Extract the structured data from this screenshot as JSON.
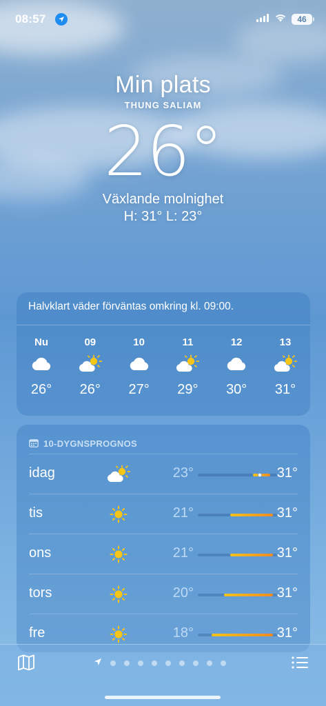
{
  "status_bar": {
    "time": "08:57",
    "battery": "46",
    "icons": [
      "location-arrow-icon",
      "cellular-signal-icon",
      "wifi-icon",
      "battery-icon"
    ]
  },
  "current": {
    "location": "Min plats",
    "sublocation": "THUNG SALIAM",
    "temperature": "26°",
    "condition": "Växlande molnighet",
    "hilo": "H: 31°  L: 23°"
  },
  "hourly": {
    "summary": "Halvklart väder förväntas omkring kl. 09:00.",
    "items": [
      {
        "label": "Nu",
        "icon": "cloud-icon",
        "temp": "26°"
      },
      {
        "label": "09",
        "icon": "partly-cloudy-icon",
        "temp": "26°"
      },
      {
        "label": "10",
        "icon": "cloud-icon",
        "temp": "27°"
      },
      {
        "label": "11",
        "icon": "partly-cloudy-icon",
        "temp": "29°"
      },
      {
        "label": "12",
        "icon": "cloud-icon",
        "temp": "30°"
      },
      {
        "label": "13",
        "icon": "partly-cloudy-icon",
        "temp": "31°"
      }
    ]
  },
  "daily": {
    "header": "10-DYGNSPROGNOS",
    "range": [
      18,
      31
    ],
    "days": [
      {
        "name": "idag",
        "icon": "partly-cloudy-icon",
        "low": "23°",
        "high": "31°",
        "low_val": 23,
        "high_val": 31,
        "current_val": 26
      },
      {
        "name": "tis",
        "icon": "sun-icon",
        "low": "21°",
        "high": "31°",
        "low_val": 21,
        "high_val": 31
      },
      {
        "name": "ons",
        "icon": "sun-icon",
        "low": "21°",
        "high": "31°",
        "low_val": 21,
        "high_val": 31
      },
      {
        "name": "tors",
        "icon": "sun-icon",
        "low": "20°",
        "high": "31°",
        "low_val": 20,
        "high_val": 31
      },
      {
        "name": "fre",
        "icon": "sun-icon",
        "low": "18°",
        "high": "31°",
        "low_val": 18,
        "high_val": 31
      }
    ]
  },
  "bottom_bar": {
    "page_count": 9,
    "icons": [
      "map-icon",
      "location-arrow-icon",
      "list-icon"
    ]
  },
  "colors": {
    "accent_sun": "#f5c518",
    "bar_orange": "#f08a24",
    "bar_yellow": "#f2c31a",
    "location_blue": "#1e8cf0"
  }
}
